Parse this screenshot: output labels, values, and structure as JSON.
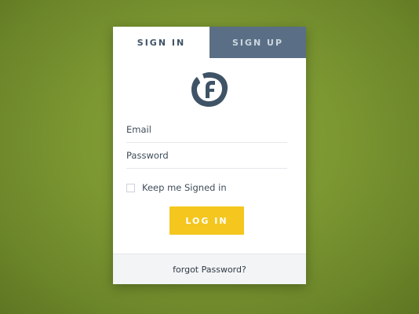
{
  "tabs": {
    "sign_in": "SIGN IN",
    "sign_up": "SIGN UP"
  },
  "logo": {
    "icon": "leaf-f-logo-icon",
    "color": "#3f5366"
  },
  "form": {
    "email_placeholder": "Email",
    "password_placeholder": "Password",
    "remember_label": "Keep me Signed in",
    "remember_checked": false,
    "login_label": "LOG IN"
  },
  "footer": {
    "forgot_label": "forgot Password?"
  },
  "colors": {
    "background": "#7c9832",
    "tab_inactive": "#5a6f85",
    "accent_button": "#f4c61e",
    "text": "#3f4d5a"
  }
}
